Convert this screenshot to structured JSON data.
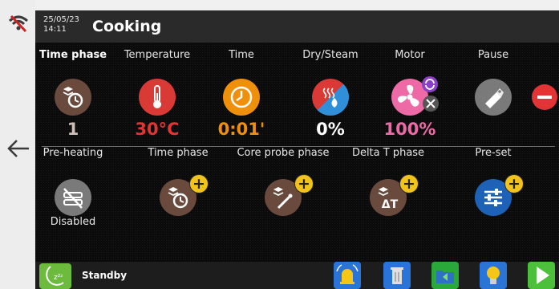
{
  "header": {
    "date": "25/05/23",
    "time": "14:11",
    "title": "Cooking"
  },
  "phase_row": {
    "items": [
      {
        "label": "Time phase",
        "value": "1"
      },
      {
        "label": "Temperature",
        "value": "30°C"
      },
      {
        "label": "Time",
        "value": "0:01'"
      },
      {
        "label": "Dry/Steam",
        "value": "0%"
      },
      {
        "label": "Motor",
        "value": "100%"
      },
      {
        "label": "Pause",
        "value": ""
      }
    ],
    "colors": {
      "time_phase": "#6b4a3e",
      "temperature": "#d93a36",
      "time": "#f0900a",
      "dry_steam": "#d93a36",
      "motor": "#ee6aa6",
      "pause": "#7a7a7a",
      "remove": "#e23434"
    }
  },
  "add_row": {
    "items": [
      {
        "label": "Pre-heating",
        "status": "Disabled"
      },
      {
        "label": "Time phase"
      },
      {
        "label": "Core probe phase"
      },
      {
        "label": "Delta T phase",
        "symbol": "ΔT"
      },
      {
        "label": "Pre-set"
      }
    ]
  },
  "footer": {
    "standby_label": "Standby",
    "zzz": "z²ᶻ"
  }
}
